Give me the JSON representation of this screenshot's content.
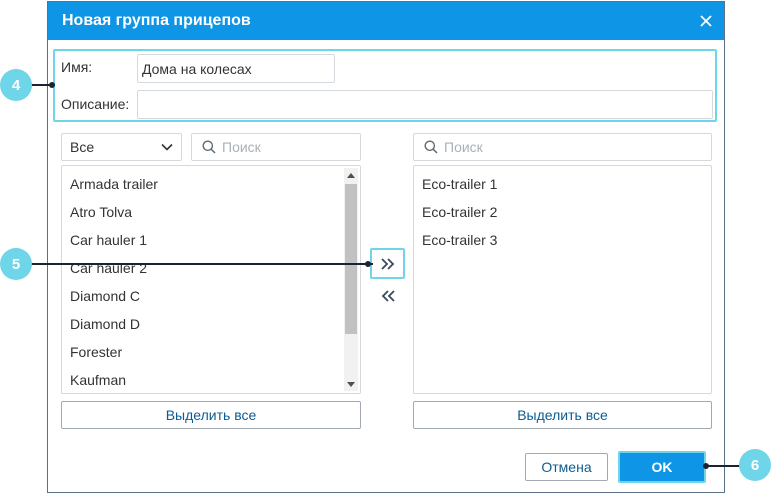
{
  "dialog": {
    "title": "Новая группа прицепов"
  },
  "form": {
    "name_label": "Имя:",
    "name_value": "Дома на колесах",
    "description_label": "Описание:",
    "description_value": ""
  },
  "left_panel": {
    "filter_selected": "Все",
    "search_placeholder": "Поиск",
    "items": [
      "Armada trailer",
      "Atro Tolva",
      "Car hauler 1",
      "Car hauler 2",
      "Diamond C",
      "Diamond D",
      "Forester",
      "Kaufman"
    ],
    "select_all_label": "Выделить все"
  },
  "right_panel": {
    "search_placeholder": "Поиск",
    "items": [
      "Eco-trailer 1",
      "Eco-trailer 2",
      "Eco-trailer 3"
    ],
    "select_all_label": "Выделить все"
  },
  "footer": {
    "cancel_label": "Отмена",
    "ok_label": "OK"
  },
  "callouts": {
    "name_group": "4",
    "transfer": "5",
    "ok": "6"
  },
  "colors": {
    "accent": "#0f95e6",
    "highlight": "#6fd5e8",
    "link": "#0c5c93"
  }
}
